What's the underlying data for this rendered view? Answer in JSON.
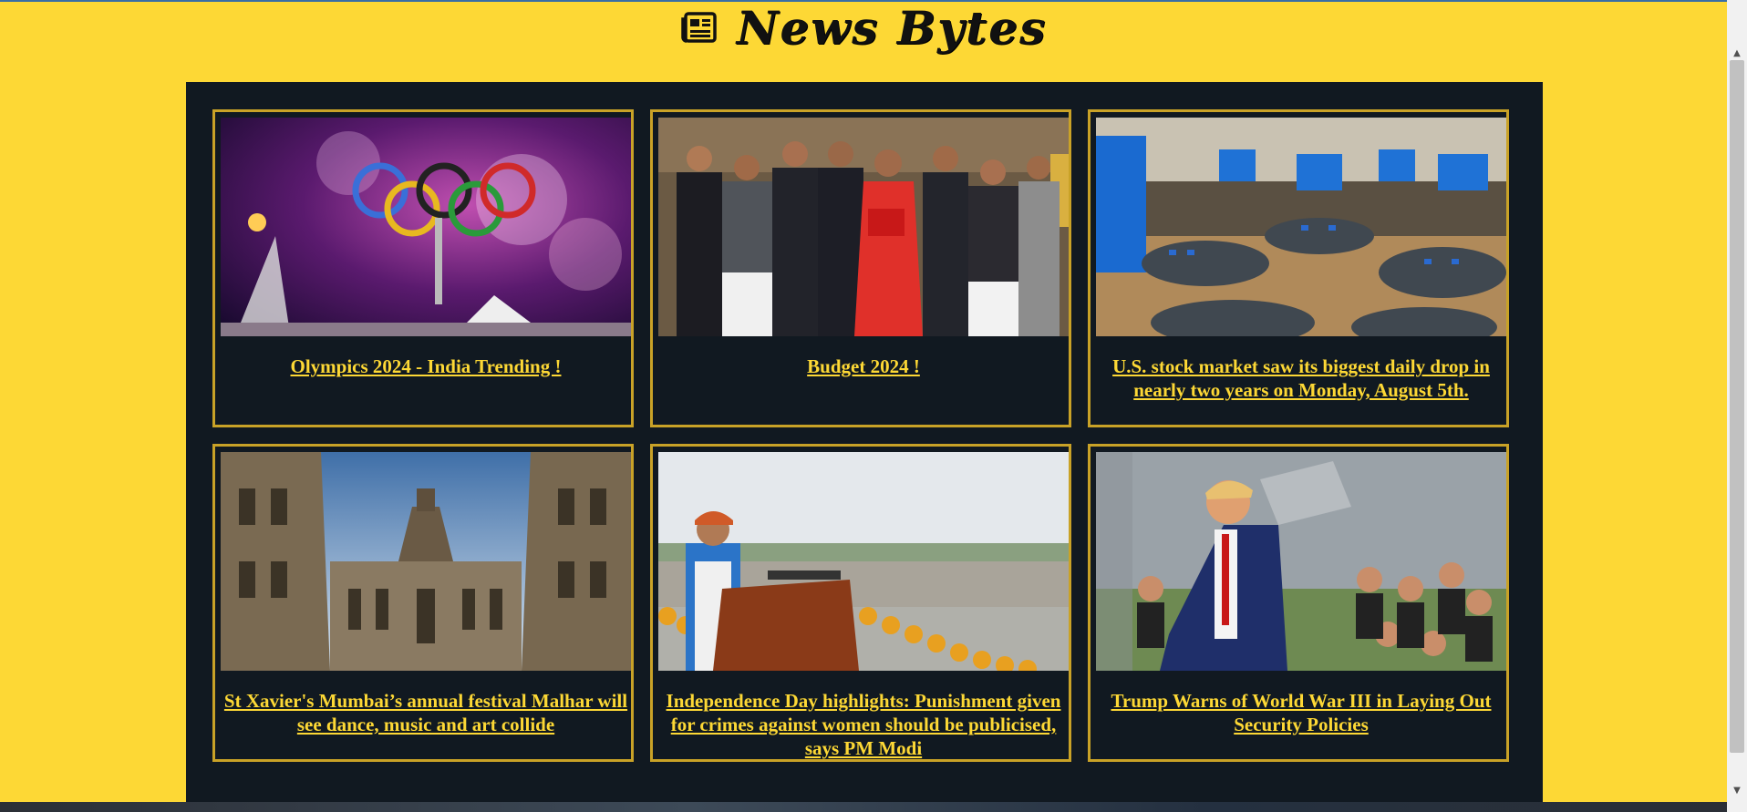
{
  "header": {
    "title": "News Bytes",
    "icon": "newspaper-icon"
  },
  "articles": [
    {
      "title": "Olympics 2024 - India Trending !",
      "image": "olympics-fireworks-image"
    },
    {
      "title": "Budget 2024 !",
      "image": "budget-officials-image"
    },
    {
      "title": "U.S. stock market saw its biggest daily drop in nearly two years on Monday, August 5th.",
      "image": "stock-exchange-floor-image"
    },
    {
      "title": "St Xavier's Mumbai’s annual festival Malhar will see dance, music and art collide",
      "image": "college-building-image"
    },
    {
      "title": "Independence Day highlights: Punishment given for crimes against women should be publicised, says PM Modi",
      "image": "pm-speech-image"
    },
    {
      "title": "Trump Warns of World War III in Laying Out Security Policies",
      "image": "trump-rally-image"
    }
  ],
  "colors": {
    "page_background": "#fdd835",
    "panel_background": "#111921",
    "card_border": "#c9a227",
    "link_color": "#fdd835"
  }
}
